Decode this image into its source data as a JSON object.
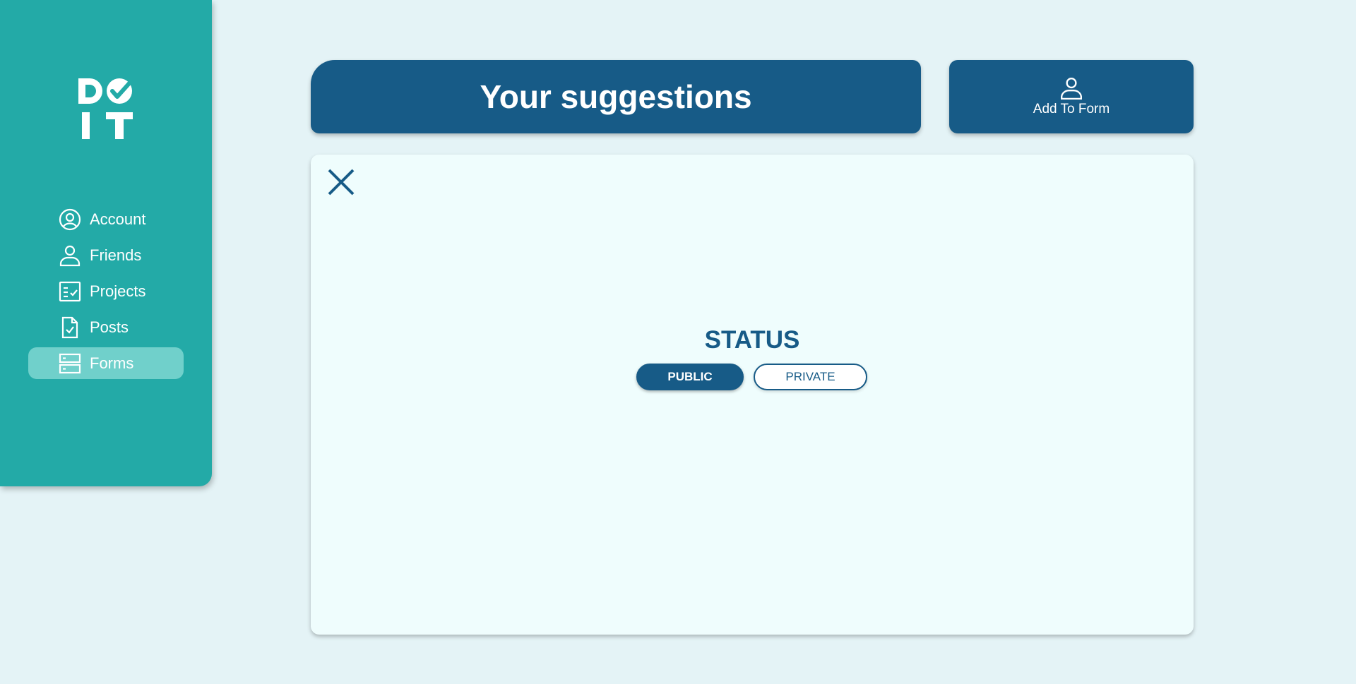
{
  "brand": {
    "logo_icon": "doit-logo-icon"
  },
  "sidebar": {
    "items": [
      {
        "label": "Account",
        "icon": "user-circle-icon",
        "active": false
      },
      {
        "label": "Friends",
        "icon": "person-icon",
        "active": false
      },
      {
        "label": "Projects",
        "icon": "checklist-icon",
        "active": false
      },
      {
        "label": "Posts",
        "icon": "document-check-icon",
        "active": false
      },
      {
        "label": "Forms",
        "icon": "server-stack-icon",
        "active": true
      }
    ]
  },
  "header": {
    "title": "Your suggestions"
  },
  "add_button": {
    "label": "Add To Form",
    "icon": "person-icon"
  },
  "panel": {
    "close_icon": "close-icon",
    "status_title": "STATUS",
    "options": [
      {
        "label": "PUBLIC",
        "selected": true
      },
      {
        "label": "PRIVATE",
        "selected": false
      }
    ]
  },
  "colors": {
    "background": "#e4f3f6",
    "sidebar": "#23aaa7",
    "sidebar_active": "#70d0cb",
    "primary": "#175b87",
    "panel": "#effdfd"
  }
}
